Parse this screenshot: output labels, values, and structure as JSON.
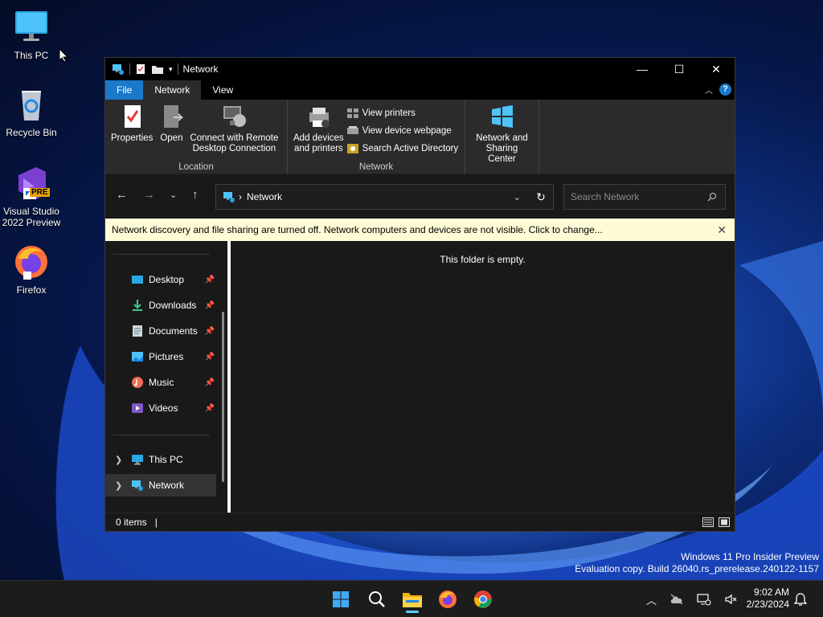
{
  "desktop": {
    "icons": [
      {
        "label": "This PC",
        "icon": "monitor-icon"
      },
      {
        "label": "Recycle Bin",
        "icon": "recycle-bin-icon"
      },
      {
        "label": "Visual Studio 2022 Preview",
        "icon": "visual-studio-icon",
        "badge": "PRE"
      },
      {
        "label": "Firefox",
        "icon": "firefox-icon"
      }
    ],
    "watermark": {
      "line1": "Windows 11 Pro Insider Preview",
      "line2": "Evaluation copy. Build 26040.rs_prerelease.240122-1157"
    }
  },
  "window": {
    "title": "Network",
    "tabs": [
      "File",
      "Network",
      "View"
    ],
    "ribbon": {
      "location": {
        "name": "Location",
        "properties": "Properties",
        "open": "Open",
        "remote_line1": "Connect with Remote",
        "remote_line2": "Desktop Connection"
      },
      "network": {
        "name": "Network",
        "add_line1": "Add devices",
        "add_line2": "and printers",
        "view_printers": "View printers",
        "view_device_webpage": "View device webpage",
        "search_ad": "Search Active Directory"
      },
      "sharing": {
        "line1": "Network and",
        "line2": "Sharing Center"
      }
    },
    "address": {
      "separator": "›",
      "path": "Network"
    },
    "search": {
      "placeholder": "Search Network"
    },
    "infobar": "Network discovery and file sharing are turned off. Network computers and devices are not visible. Click to change...",
    "nav": {
      "quick_access": [
        {
          "label": "Desktop",
          "icon": "desktop-icon"
        },
        {
          "label": "Downloads",
          "icon": "download-icon"
        },
        {
          "label": "Documents",
          "icon": "document-icon"
        },
        {
          "label": "Pictures",
          "icon": "picture-icon"
        },
        {
          "label": "Music",
          "icon": "music-icon"
        },
        {
          "label": "Videos",
          "icon": "video-icon"
        }
      ],
      "tree": [
        {
          "label": "This PC",
          "icon": "monitor-icon"
        },
        {
          "label": "Network",
          "icon": "network-icon"
        }
      ]
    },
    "content": {
      "empty_message": "This folder is empty."
    },
    "status": {
      "items": "0 items"
    }
  },
  "taskbar": {
    "apps": [
      "start-icon",
      "search-icon",
      "file-explorer-icon",
      "firefox-icon",
      "chrome-icon"
    ],
    "active_app": "file-explorer-icon",
    "clock": {
      "time": "9:02 AM",
      "date": "2/23/2024"
    }
  },
  "colors": {
    "accent": "#1979ca",
    "infobar": "#fffbd6",
    "window_bg": "#191919"
  }
}
